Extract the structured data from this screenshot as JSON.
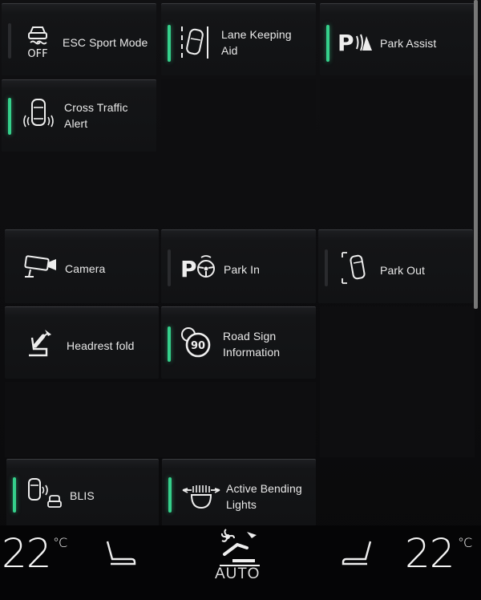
{
  "tiles": {
    "esc": {
      "label": "ESC Sport Mode",
      "active": false,
      "icon": "esc-off-icon",
      "icon_text": "OFF"
    },
    "lane": {
      "label": "Lane Keeping\nAid",
      "active": true,
      "icon": "lane-keeping-icon"
    },
    "park_assist": {
      "label": "Park Assist",
      "active": true,
      "icon": "park-assist-icon"
    },
    "cross_traffic": {
      "label": "Cross Traffic\nAlert",
      "active": true,
      "icon": "cross-traffic-icon"
    },
    "camera": {
      "label": "Camera",
      "icon": "camera-icon"
    },
    "park_in": {
      "label": "Park In",
      "active": false,
      "icon": "park-in-icon"
    },
    "park_out": {
      "label": "Park Out",
      "active": false,
      "icon": "park-out-icon"
    },
    "headrest": {
      "label": "Headrest fold",
      "icon": "headrest-fold-icon"
    },
    "road_sign": {
      "label": "Road Sign\nInformation",
      "active": true,
      "icon": "road-sign-icon",
      "icon_text": "90"
    },
    "blis": {
      "label": "BLIS",
      "active": true,
      "icon": "blis-icon"
    },
    "bending": {
      "label": "Active Bending\nLights",
      "active": true,
      "icon": "bending-lights-icon"
    }
  },
  "climate": {
    "left_temp": "22",
    "right_temp": "22",
    "unit": "°C",
    "mode": "AUTO"
  },
  "colors": {
    "indicator_on": "#35d08b",
    "indicator_off": "#2a2b2e",
    "background": "#0b0b0d"
  }
}
